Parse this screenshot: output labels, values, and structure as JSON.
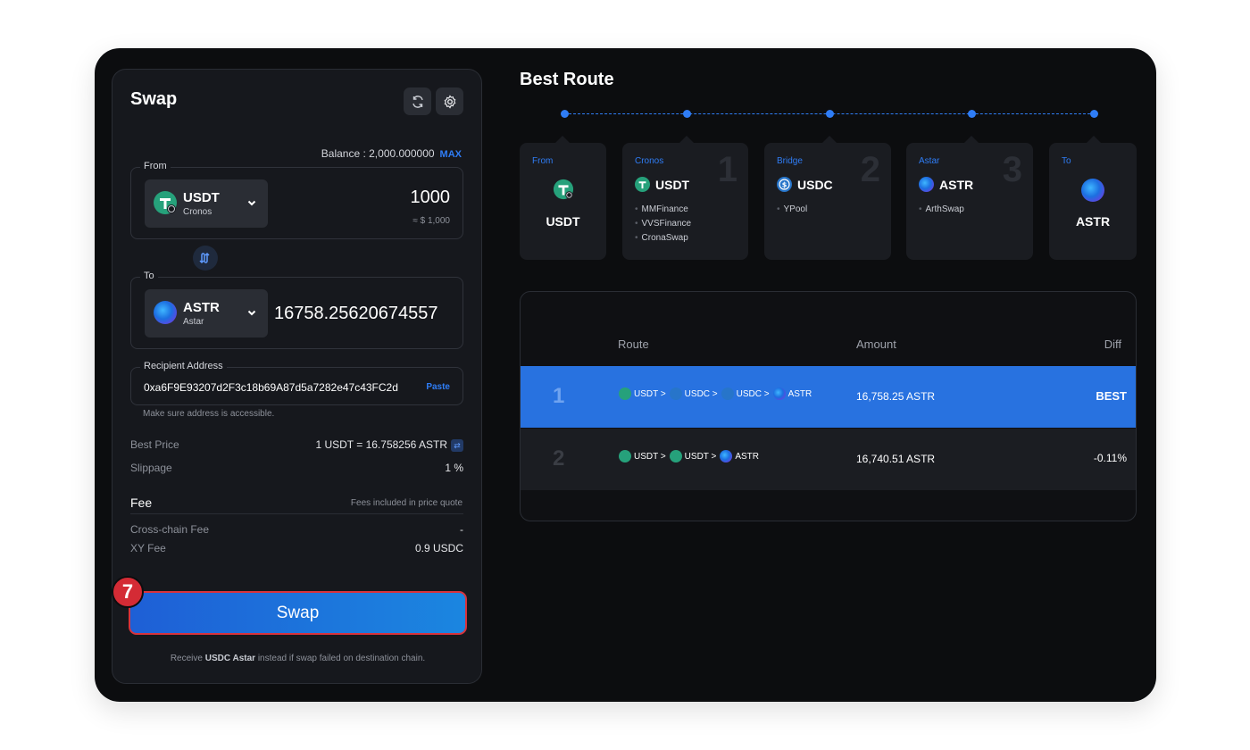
{
  "swap": {
    "title": "Swap",
    "balance_text": "Balance : 2,000.000000",
    "max_label": "MAX",
    "from": {
      "label": "From",
      "symbol": "USDT",
      "chain": "Cronos",
      "amount": "1000",
      "usd_value": "≈ $ 1,000"
    },
    "to": {
      "label": "To",
      "symbol": "ASTR",
      "chain": "Astar",
      "amount": "16758.25620674557"
    },
    "recipient": {
      "label": "Recipient Address",
      "address": "0xa6F9E93207d2F3c18b69A87d5a7282e47c43FC2d",
      "paste_label": "Paste",
      "hint": "Make sure address is accessible."
    },
    "best_price": {
      "label": "Best Price",
      "value": "1 USDT = 16.758256 ASTR"
    },
    "slippage": {
      "label": "Slippage",
      "value": "1 %"
    },
    "fee": {
      "title": "Fee",
      "note": "Fees included in price quote",
      "cross_chain": {
        "label": "Cross-chain Fee",
        "value": "-"
      },
      "xy": {
        "label": "XY Fee",
        "value": "0.9 USDC"
      }
    },
    "button_label": "Swap",
    "step_badge": "7",
    "fallback": {
      "prefix": "Receive",
      "token": "USDC Astar",
      "suffix": "instead if swap failed on destination chain."
    }
  },
  "best_route": {
    "title": "Best Route",
    "steps": [
      {
        "caption": "From",
        "symbol": "USDT"
      },
      {
        "caption": "Cronos",
        "number": "1",
        "symbol": "USDT",
        "dexes": [
          "MMFinance",
          "VVSFinance",
          "CronaSwap"
        ]
      },
      {
        "caption": "Bridge",
        "number": "2",
        "symbol": "USDC",
        "dexes": [
          "YPool"
        ]
      },
      {
        "caption": "Astar",
        "number": "3",
        "symbol": "ASTR",
        "dexes": [
          "ArthSwap"
        ]
      },
      {
        "caption": "To",
        "symbol": "ASTR"
      }
    ]
  },
  "routes_table": {
    "headers": {
      "route": "Route",
      "amount": "Amount",
      "diff": "Diff"
    },
    "rows": [
      {
        "rank": "1",
        "path": [
          "USDT >",
          "USDC >",
          "USDC >",
          "ASTR"
        ],
        "amount": "16,758.25 ASTR",
        "diff": "BEST"
      },
      {
        "rank": "2",
        "path": [
          "USDT >",
          "USDT >",
          "ASTR"
        ],
        "amount": "16,740.51 ASTR",
        "diff": "-0.11%"
      }
    ]
  },
  "colors": {
    "accent": "#2f7df6",
    "highlight_row": "#2872e0",
    "step_badge": "#d42b35",
    "frame": "#0c0d0f"
  },
  "icons": [
    "refresh-icon",
    "gear-icon",
    "chevron-down-icon",
    "swap-direction-icon",
    "usdt-icon",
    "usdc-icon",
    "astr-icon"
  ]
}
